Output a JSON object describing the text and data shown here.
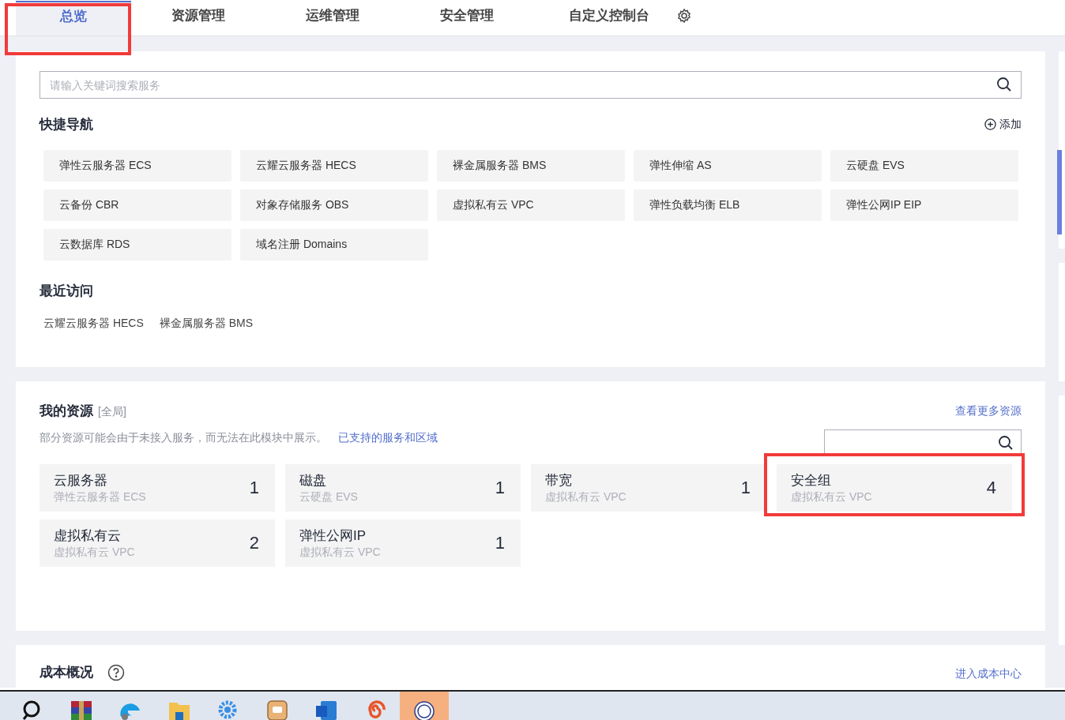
{
  "tabs": [
    {
      "label": "总览",
      "selected": true
    },
    {
      "label": "资源管理",
      "selected": false
    },
    {
      "label": "运维管理",
      "selected": false
    },
    {
      "label": "安全管理",
      "selected": false
    },
    {
      "label": "自定义控制台",
      "selected": false
    }
  ],
  "search": {
    "placeholder": "请输入关键词搜索服务"
  },
  "quick_nav": {
    "title": "快捷导航",
    "add_label": "添加",
    "items": [
      "弹性云服务器 ECS",
      "云耀云服务器 HECS",
      "裸金属服务器 BMS",
      "弹性伸缩 AS",
      "云硬盘 EVS",
      "云备份 CBR",
      "对象存储服务 OBS",
      "虚拟私有云 VPC",
      "弹性负载均衡 ELB",
      "弹性公网IP EIP",
      "云数据库 RDS",
      "域名注册 Domains"
    ]
  },
  "recent": {
    "title": "最近访问",
    "items": [
      "云耀云服务器 HECS",
      "裸金属服务器 BMS"
    ]
  },
  "resources": {
    "title": "我的资源",
    "scope": "[全局]",
    "more_link": "查看更多资源",
    "notice": "部分资源可能会由于未接入服务，而无法在此模块中展示。",
    "notice_link": "已支持的服务和区域",
    "cards": [
      {
        "name": "云服务器",
        "service": "弹性云服务器 ECS",
        "count": "1",
        "highlighted": false
      },
      {
        "name": "磁盘",
        "service": "云硬盘 EVS",
        "count": "1",
        "highlighted": false
      },
      {
        "name": "带宽",
        "service": "虚拟私有云 VPC",
        "count": "1",
        "highlighted": false
      },
      {
        "name": "安全组",
        "service": "虚拟私有云 VPC",
        "count": "4",
        "highlighted": true
      },
      {
        "name": "虚拟私有云",
        "service": "虚拟私有云 VPC",
        "count": "2",
        "highlighted": false
      },
      {
        "name": "弹性公网IP",
        "service": "虚拟私有云 VPC",
        "count": "1",
        "highlighted": false
      }
    ]
  },
  "cost": {
    "title": "成本概况",
    "link": "进入成本中心"
  },
  "taskbar": [
    {
      "kind": "search",
      "active": false
    },
    {
      "kind": "archive",
      "active": false
    },
    {
      "kind": "browser",
      "active": false
    },
    {
      "kind": "folder",
      "active": false
    },
    {
      "kind": "gear",
      "active": false
    },
    {
      "kind": "chat",
      "active": false
    },
    {
      "kind": "word",
      "active": false
    },
    {
      "kind": "snail",
      "active": false
    },
    {
      "kind": "seal",
      "active": true
    }
  ]
}
